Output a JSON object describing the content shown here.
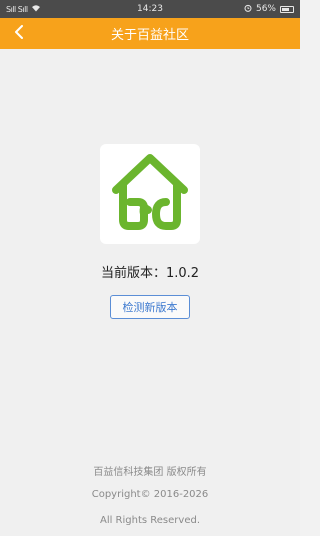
{
  "status_bar": {
    "signal_left": "Sıll Sıll",
    "time": "14:23",
    "battery_percent": "56%"
  },
  "header": {
    "title": "关于百益社区",
    "back_icon": "chevron-left-icon"
  },
  "about": {
    "logo_icon": "house-bcd-logo",
    "version_label": "当前版本：1.0.2",
    "check_button_label": "检测新版本"
  },
  "footer": {
    "company": "百益信科技集团 版权所有",
    "copyright": "Copyright© 2016-2026",
    "rights": "All Rights Reserved."
  },
  "colors": {
    "header_bg": "#f7a21b",
    "logo_green": "#6bb52e",
    "button_blue": "#3f7bd0"
  }
}
